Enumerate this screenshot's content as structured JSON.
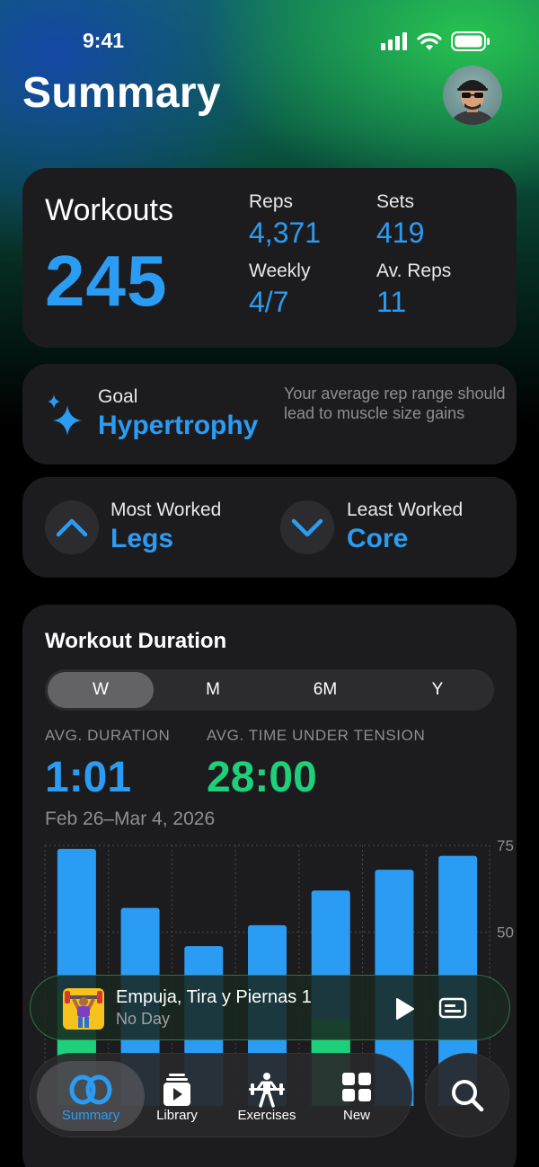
{
  "status": {
    "time": "9:41"
  },
  "header": {
    "title": "Summary"
  },
  "workouts": {
    "label": "Workouts",
    "value": "245",
    "stats": [
      {
        "label": "Reps",
        "value": "4,371"
      },
      {
        "label": "Sets",
        "value": "419"
      },
      {
        "label": "Weekly",
        "value": "4/7"
      },
      {
        "label": "Av. Reps",
        "value": "11"
      }
    ]
  },
  "goal": {
    "label": "Goal",
    "value": "Hypertrophy",
    "description": "Your average rep range should lead to muscle size gains"
  },
  "worked": {
    "most_label": "Most Worked",
    "most_value": "Legs",
    "least_label": "Least Worked",
    "least_value": "Core"
  },
  "duration": {
    "title": "Workout Duration",
    "segments": [
      "W",
      "M",
      "6M",
      "Y"
    ],
    "selected_segment": "W",
    "avg_duration_label": "AVG. DURATION",
    "avg_duration_value": "1:01",
    "avg_tension_label": "AVG. TIME UNDER TENSION",
    "avg_tension_value": "28:00",
    "date_range": "Feb 26–Mar 4, 2026"
  },
  "chart_data": {
    "type": "bar",
    "title": "",
    "xlabel": "",
    "ylabel": "",
    "ylim": [
      0,
      75
    ],
    "y_ticks": [
      "75",
      "50"
    ],
    "series": [
      {
        "values": [
          74,
          57,
          46,
          52,
          62,
          68,
          72
        ]
      },
      {
        "values": [
          33,
          0,
          0,
          0,
          25,
          0,
          0
        ]
      }
    ],
    "colors": {
      "duration": "#2b9cf3",
      "tension": "#1fd07a"
    }
  },
  "now_playing": {
    "title": "Empuja, Tira y Piernas 1",
    "subtitle": "No Day"
  },
  "tabs": [
    {
      "label": "Summary",
      "icon": "summary-icon"
    },
    {
      "label": "Library",
      "icon": "library-icon"
    },
    {
      "label": "Exercises",
      "icon": "exercises-icon"
    },
    {
      "label": "New",
      "icon": "new-grid-icon"
    }
  ],
  "colors": {
    "accent": "#2b9cf3",
    "tension": "#1fd07a",
    "card": "#1c1c1e"
  }
}
